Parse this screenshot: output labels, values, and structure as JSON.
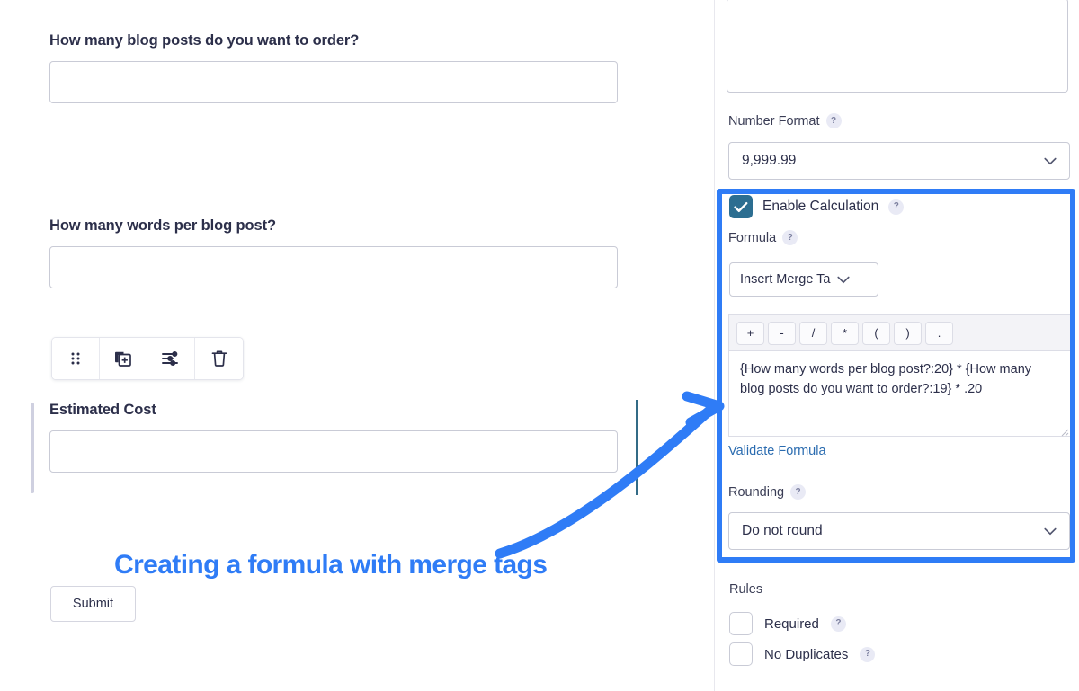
{
  "form": {
    "fields": [
      {
        "label": "How many blog posts do you want to order?",
        "value": "",
        "placeholder": ""
      },
      {
        "label": "How many words per blog post?",
        "value": "",
        "placeholder": ""
      },
      {
        "label": "Estimated Cost",
        "value": "",
        "placeholder": ""
      }
    ],
    "submit_label": "Submit"
  },
  "field_toolbar": {
    "buttons": [
      {
        "name": "drag-handle-icon",
        "title": "Move"
      },
      {
        "name": "duplicate-icon",
        "title": "Duplicate"
      },
      {
        "name": "settings-sliders-icon",
        "title": "Settings"
      },
      {
        "name": "trash-icon",
        "title": "Delete"
      }
    ]
  },
  "annotation": {
    "caption": "Creating a formula with merge tags",
    "accent_color": "#2f7cf6",
    "divider_color": "#336b86"
  },
  "settings": {
    "description_value": "",
    "number_format": {
      "label": "Number Format",
      "help": "?",
      "selected": "9,999.99"
    },
    "enable_calculation": {
      "label": "Enable Calculation",
      "help": "?",
      "checked": true
    },
    "formula": {
      "label": "Formula",
      "help": "?",
      "merge_tag_button": "Insert Merge Ta",
      "operators": [
        "+",
        "-",
        "/",
        "*",
        "(",
        ")",
        "."
      ],
      "value": "{How many words per blog post?:20} * {How many blog posts do you want to order?:19} * .20",
      "validate_link": "Validate Formula"
    },
    "rounding": {
      "label": "Rounding",
      "help": "?",
      "selected": "Do not round"
    },
    "rules": {
      "label": "Rules",
      "items": [
        {
          "label": "Required",
          "help": "?",
          "checked": false
        },
        {
          "label": "No Duplicates",
          "help": "?",
          "checked": false
        }
      ]
    }
  }
}
